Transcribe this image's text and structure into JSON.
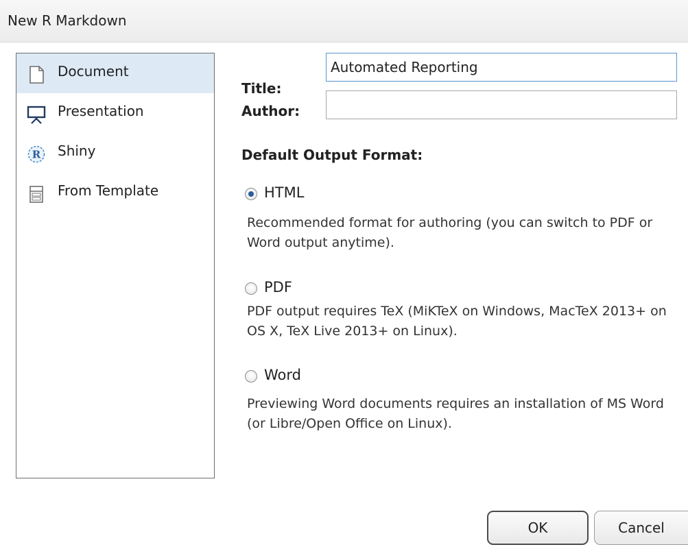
{
  "window": {
    "title": "New R Markdown"
  },
  "sidebar": {
    "items": [
      {
        "label": "Document",
        "icon": "document-icon",
        "selected": true
      },
      {
        "label": "Presentation",
        "icon": "presentation-icon",
        "selected": false
      },
      {
        "label": "Shiny",
        "icon": "shiny-r-icon",
        "selected": false
      },
      {
        "label": "From Template",
        "icon": "template-icon",
        "selected": false
      }
    ]
  },
  "form": {
    "title_label": "Title:",
    "title_value": "Automated Reporting",
    "author_label": "Author:",
    "author_value": ""
  },
  "output": {
    "heading": "Default Output Format:",
    "options": [
      {
        "label": "HTML",
        "checked": true,
        "description": "Recommended format for authoring (you can switch to PDF or Word output anytime)."
      },
      {
        "label": "PDF",
        "checked": false,
        "description": "PDF output requires TeX (MiKTeX on Windows, MacTeX 2013+ on OS X, TeX Live 2013+ on Linux)."
      },
      {
        "label": "Word",
        "checked": false,
        "description": "Previewing Word documents requires an installation of MS Word (or Libre/Open Office on Linux)."
      }
    ]
  },
  "buttons": {
    "ok": "OK",
    "cancel": "Cancel"
  },
  "colors": {
    "selection": "#dde9f5",
    "radio_dot": "#2a5d9b",
    "focus_border": "#5a94d2"
  }
}
